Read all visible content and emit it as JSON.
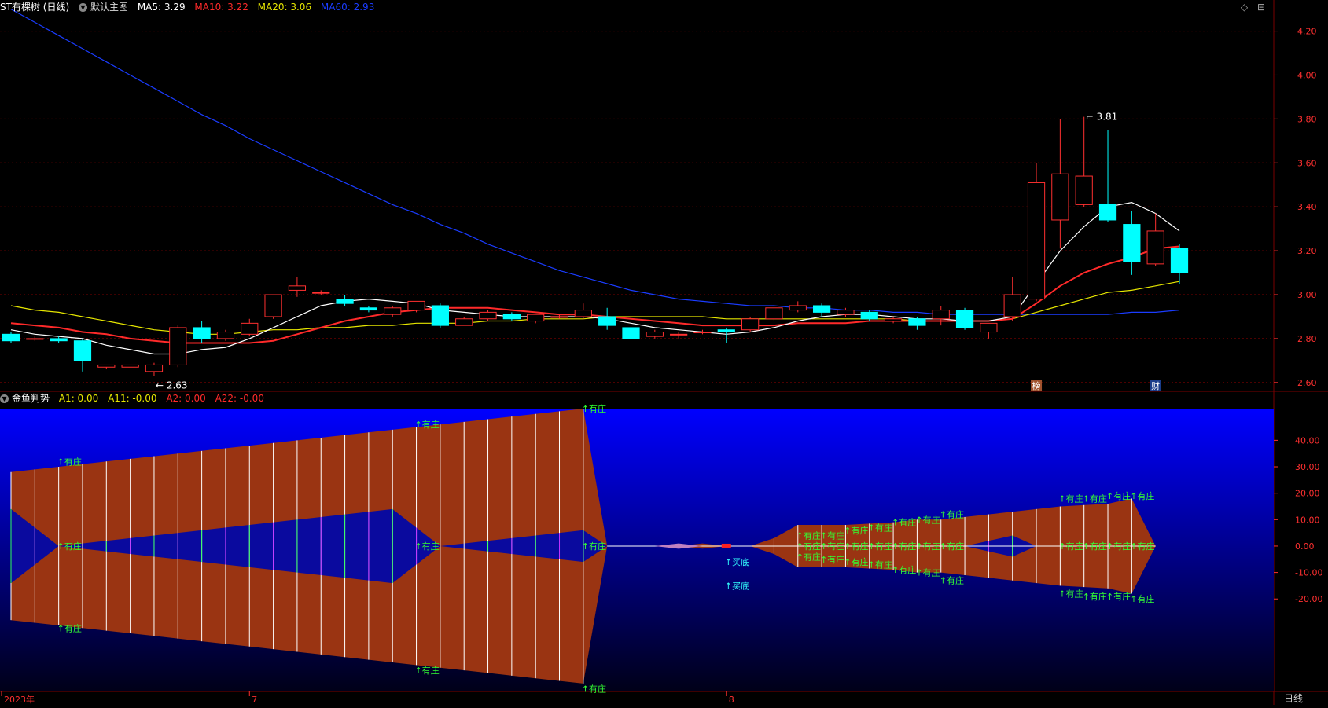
{
  "main": {
    "stock_name": "ST有棵树 (日线)",
    "template": "默认主图",
    "ma": [
      {
        "label": "MA5: 3.29",
        "color": "#ffffff"
      },
      {
        "label": "MA10: 3.22",
        "color": "#ff2a2a"
      },
      {
        "label": "MA20: 3.06",
        "color": "#e6e600"
      },
      {
        "label": "MA60: 2.93",
        "color": "#1a3cff"
      }
    ],
    "y_ticks": [
      "4.20",
      "4.00",
      "3.80",
      "3.60",
      "3.40",
      "3.20",
      "3.00",
      "2.80",
      "2.60"
    ],
    "high_label": "3.81",
    "low_label": "2.63",
    "markers": [
      "榜",
      "财"
    ]
  },
  "indicator": {
    "name": "金鱼判势",
    "params": [
      {
        "label": "A1: 0.00",
        "color": "#e6e600"
      },
      {
        "label": "A11: -0.00",
        "color": "#e6e600"
      },
      {
        "label": "A2: 0.00",
        "color": "#ff2a2a"
      },
      {
        "label": "A22: -0.00",
        "color": "#ff2a2a"
      }
    ],
    "y_ticks": [
      "40.00",
      "30.00",
      "20.00",
      "10.00",
      "0.00",
      "-10.00",
      "-20.00"
    ],
    "signal_youzhuang": "↑有庄",
    "signal_maidi": "↑买底"
  },
  "x_axis": {
    "labels": [
      "2023年",
      "7",
      "8"
    ]
  },
  "period": "日线",
  "window_icons": [
    "◇",
    "⊟"
  ],
  "colors": {
    "up": "#ff3030",
    "down": "#00ffff",
    "ma5": "#ffffff",
    "ma10": "#ff2a2a",
    "ma20": "#e6e600",
    "ma60": "#1a3cff",
    "indicator_bg_top": "#0000ff",
    "indicator_bg_bottom": "#000018",
    "fish_body": "#9a3412",
    "grid": "#7a0000",
    "axis_text": "#ff3030",
    "signal_green": "#33ff33",
    "signal_cyan": "#33ffff"
  },
  "chart_data": {
    "type": "candlestick",
    "x_labels": [
      "2023年",
      "7",
      "8"
    ],
    "ylim": [
      2.56,
      4.27
    ],
    "candles": [
      [
        2.82,
        2.79,
        2.83,
        2.78
      ],
      [
        2.8,
        2.8,
        2.81,
        2.79
      ],
      [
        2.8,
        2.79,
        2.81,
        2.78
      ],
      [
        2.79,
        2.7,
        2.8,
        2.65
      ],
      [
        2.67,
        2.68,
        2.68,
        2.66
      ],
      [
        2.67,
        2.68,
        2.68,
        2.67
      ],
      [
        2.65,
        2.68,
        2.69,
        2.63
      ],
      [
        2.68,
        2.85,
        2.86,
        2.67
      ],
      [
        2.85,
        2.8,
        2.88,
        2.78
      ],
      [
        2.8,
        2.83,
        2.84,
        2.79
      ],
      [
        2.82,
        2.87,
        2.89,
        2.81
      ],
      [
        2.9,
        3.0,
        3.0,
        2.89
      ],
      [
        3.02,
        3.04,
        3.08,
        2.99
      ],
      [
        3.01,
        3.01,
        3.02,
        3.0
      ],
      [
        2.98,
        2.96,
        3.0,
        2.95
      ],
      [
        2.94,
        2.93,
        2.95,
        2.92
      ],
      [
        2.91,
        2.94,
        2.95,
        2.9
      ],
      [
        2.93,
        2.97,
        2.97,
        2.92
      ],
      [
        2.95,
        2.86,
        2.96,
        2.85
      ],
      [
        2.86,
        2.89,
        2.9,
        2.86
      ],
      [
        2.89,
        2.92,
        2.93,
        2.88
      ],
      [
        2.91,
        2.89,
        2.92,
        2.88
      ],
      [
        2.88,
        2.91,
        2.91,
        2.87
      ],
      [
        2.9,
        2.9,
        2.91,
        2.89
      ],
      [
        2.9,
        2.93,
        2.96,
        2.89
      ],
      [
        2.9,
        2.86,
        2.94,
        2.84
      ],
      [
        2.85,
        2.8,
        2.86,
        2.78
      ],
      [
        2.81,
        2.83,
        2.84,
        2.8
      ],
      [
        2.82,
        2.82,
        2.83,
        2.8
      ],
      [
        2.83,
        2.83,
        2.84,
        2.82
      ],
      [
        2.84,
        2.83,
        2.85,
        2.78
      ],
      [
        2.84,
        2.89,
        2.9,
        2.83
      ],
      [
        2.89,
        2.94,
        2.94,
        2.88
      ],
      [
        2.93,
        2.95,
        2.97,
        2.92
      ],
      [
        2.95,
        2.92,
        2.96,
        2.9
      ],
      [
        2.91,
        2.93,
        2.94,
        2.9
      ],
      [
        2.92,
        2.89,
        2.93,
        2.88
      ],
      [
        2.88,
        2.89,
        2.9,
        2.87
      ],
      [
        2.89,
        2.86,
        2.9,
        2.84
      ],
      [
        2.89,
        2.93,
        2.95,
        2.86
      ],
      [
        2.93,
        2.85,
        2.94,
        2.84
      ],
      [
        2.83,
        2.87,
        2.87,
        2.8
      ],
      [
        2.9,
        3.0,
        3.08,
        2.88
      ],
      [
        2.98,
        3.51,
        3.6,
        2.97
      ],
      [
        3.34,
        3.55,
        3.8,
        3.21
      ],
      [
        3.41,
        3.54,
        3.81,
        3.4
      ],
      [
        3.41,
        3.34,
        3.75,
        3.33
      ],
      [
        3.32,
        3.15,
        3.38,
        3.09
      ],
      [
        3.14,
        3.29,
        3.37,
        3.13
      ],
      [
        3.21,
        3.1,
        3.23,
        3.05
      ]
    ],
    "ma5": [
      2.84,
      2.82,
      2.81,
      2.8,
      2.77,
      2.75,
      2.73,
      2.73,
      2.75,
      2.76,
      2.8,
      2.85,
      2.9,
      2.95,
      2.97,
      2.98,
      2.97,
      2.96,
      2.93,
      2.92,
      2.91,
      2.9,
      2.9,
      2.9,
      2.9,
      2.89,
      2.87,
      2.85,
      2.84,
      2.83,
      2.82,
      2.83,
      2.85,
      2.88,
      2.9,
      2.91,
      2.91,
      2.9,
      2.89,
      2.89,
      2.88,
      2.88,
      2.9,
      3.05,
      3.2,
      3.31,
      3.4,
      3.42,
      3.37,
      3.29
    ],
    "ma10": [
      2.87,
      2.86,
      2.85,
      2.83,
      2.82,
      2.8,
      2.79,
      2.78,
      2.78,
      2.78,
      2.78,
      2.79,
      2.82,
      2.85,
      2.88,
      2.9,
      2.92,
      2.93,
      2.94,
      2.94,
      2.94,
      2.93,
      2.92,
      2.91,
      2.91,
      2.9,
      2.89,
      2.88,
      2.87,
      2.86,
      2.86,
      2.86,
      2.86,
      2.87,
      2.87,
      2.87,
      2.88,
      2.88,
      2.88,
      2.88,
      2.88,
      2.88,
      2.89,
      2.96,
      3.04,
      3.1,
      3.14,
      3.17,
      3.21,
      3.22
    ],
    "ma20": [
      2.95,
      2.93,
      2.92,
      2.9,
      2.88,
      2.86,
      2.84,
      2.83,
      2.82,
      2.82,
      2.83,
      2.84,
      2.84,
      2.85,
      2.85,
      2.86,
      2.86,
      2.87,
      2.87,
      2.87,
      2.88,
      2.88,
      2.89,
      2.89,
      2.89,
      2.9,
      2.9,
      2.9,
      2.9,
      2.9,
      2.89,
      2.89,
      2.89,
      2.89,
      2.89,
      2.89,
      2.89,
      2.89,
      2.88,
      2.88,
      2.88,
      2.88,
      2.89,
      2.92,
      2.95,
      2.98,
      3.01,
      3.02,
      3.04,
      3.06
    ],
    "ma60": [
      4.3,
      4.24,
      4.18,
      4.12,
      4.06,
      4.0,
      3.94,
      3.88,
      3.82,
      3.77,
      3.71,
      3.66,
      3.61,
      3.56,
      3.51,
      3.46,
      3.41,
      3.37,
      3.32,
      3.28,
      3.23,
      3.19,
      3.15,
      3.11,
      3.08,
      3.05,
      3.02,
      3.0,
      2.98,
      2.97,
      2.96,
      2.95,
      2.95,
      2.94,
      2.94,
      2.93,
      2.93,
      2.92,
      2.92,
      2.91,
      2.91,
      2.91,
      2.91,
      2.91,
      2.91,
      2.91,
      2.91,
      2.92,
      2.92,
      2.93
    ],
    "indicator_ylim": [
      -55,
      52
    ],
    "fish_outer": [
      [
        0,
        28
      ],
      [
        2,
        30
      ],
      [
        4,
        32
      ],
      [
        6,
        34
      ],
      [
        8,
        36
      ],
      [
        10,
        38
      ],
      [
        12,
        40
      ],
      [
        14,
        42
      ],
      [
        16,
        44
      ],
      [
        18,
        46
      ],
      [
        20,
        48
      ],
      [
        22,
        50
      ],
      [
        24,
        52
      ],
      [
        25,
        0
      ],
      [
        26,
        0
      ],
      [
        28,
        0
      ],
      [
        29,
        -1
      ],
      [
        30,
        0
      ],
      [
        31,
        0
      ],
      [
        32,
        3
      ],
      [
        33,
        8
      ],
      [
        35,
        8
      ],
      [
        37,
        9
      ],
      [
        38,
        10
      ],
      [
        39,
        10
      ],
      [
        40,
        11
      ],
      [
        41,
        12
      ],
      [
        42,
        13
      ],
      [
        44,
        15
      ],
      [
        46,
        16
      ],
      [
        47,
        18
      ],
      [
        48,
        0
      ]
    ],
    "fish_inner": [
      [
        0,
        14
      ],
      [
        2,
        0
      ],
      [
        4,
        2
      ],
      [
        6,
        4
      ],
      [
        8,
        6
      ],
      [
        10,
        8
      ],
      [
        12,
        10
      ],
      [
        14,
        12
      ],
      [
        16,
        14
      ],
      [
        18,
        0
      ],
      [
        20,
        2
      ],
      [
        22,
        4
      ],
      [
        24,
        6
      ],
      [
        25,
        0
      ],
      [
        40,
        0
      ],
      [
        42,
        4
      ],
      [
        43,
        0
      ],
      [
        48,
        0
      ]
    ]
  }
}
